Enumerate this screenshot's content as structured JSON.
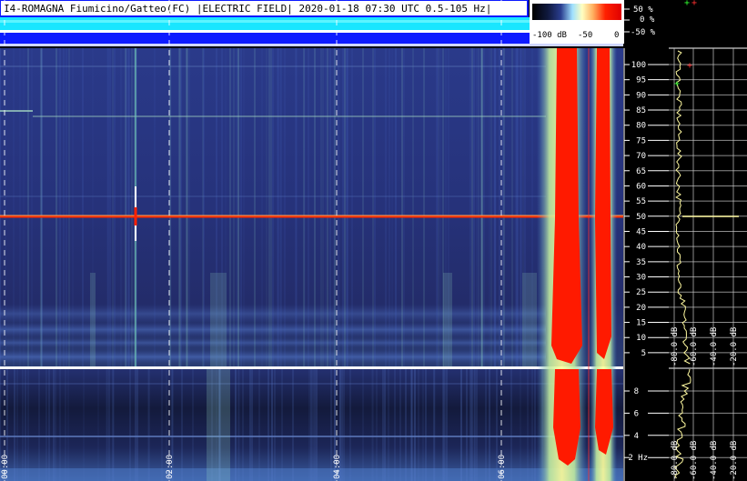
{
  "header": {
    "title": "I4-ROMAGNA Fiumicino/Gatteo(FC) |ELECTRIC FIELD| 2020-01-18 07:30 UTC 0.5-105 Hz|"
  },
  "colorbar": {
    "label_min": "-100 dB",
    "label_mid": "-50",
    "label_max": "0",
    "pct_top": "50 %",
    "pct_mid": "0 %",
    "pct_bot": "-50 %"
  },
  "spectrogram": {
    "freq_labels_upper": [
      "100",
      "95",
      "90",
      "85",
      "80",
      "75",
      "70",
      "65",
      "60",
      "55",
      "50",
      "45",
      "40",
      "35",
      "30",
      "25",
      "20",
      "15",
      "10",
      "5"
    ],
    "freq_labels_lower": [
      "8",
      "6",
      "4",
      "2 Hz"
    ],
    "time_labels": [
      "00:00",
      "02:00",
      "04:00",
      "06:00"
    ]
  },
  "spectrum_panel": {
    "db_labels_upper": [
      "-80.0 dB",
      "-60.0 dB",
      "-40.0 dB",
      "-20.0 dB"
    ],
    "db_labels_lower": [
      "-80.0 dB",
      "-60.0 dB",
      "-40.0 dB",
      "-20.0 dB"
    ]
  },
  "colors": {
    "background": "#000000",
    "spectrogram_base": "#24306a",
    "signal_red": "#ff1a00",
    "trace_yellow": "#fffaa0",
    "header_cyan": "#19e6ff",
    "header_blue": "#0d1bff"
  }
}
